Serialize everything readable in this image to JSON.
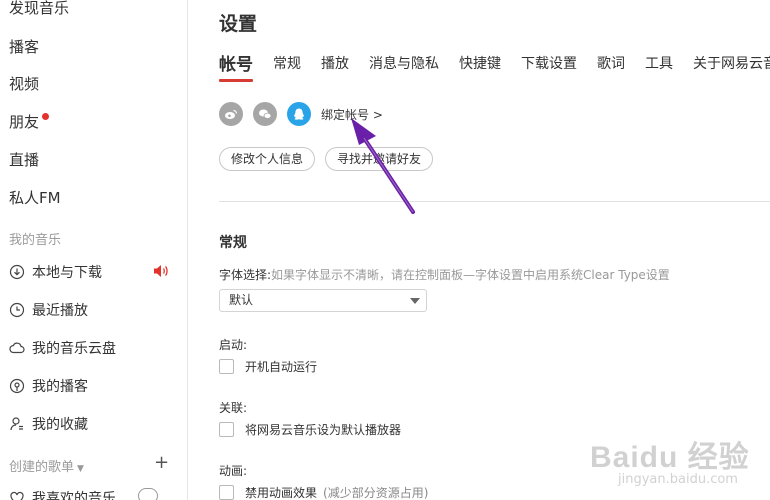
{
  "sidebar": {
    "nav": [
      {
        "label": "发现音乐"
      },
      {
        "label": "播客"
      },
      {
        "label": "视频"
      },
      {
        "label": "朋友"
      },
      {
        "label": "直播"
      },
      {
        "label": "私人FM"
      }
    ],
    "my_music_title": "我的音乐",
    "my_music": [
      {
        "label": "本地与下载",
        "icon": "download-icon"
      },
      {
        "label": "最近播放",
        "icon": "clock-icon"
      },
      {
        "label": "我的音乐云盘",
        "icon": "cloud-icon"
      },
      {
        "label": "我的播客",
        "icon": "podcast-icon"
      },
      {
        "label": "我的收藏",
        "icon": "collection-icon"
      }
    ],
    "created_playlists_title": "创建的歌单",
    "playlists": [
      {
        "label": "我喜欢的音乐"
      }
    ]
  },
  "main": {
    "title": "设置",
    "tabs": [
      {
        "label": "帐号"
      },
      {
        "label": "常规"
      },
      {
        "label": "播放"
      },
      {
        "label": "消息与隐私"
      },
      {
        "label": "快捷键"
      },
      {
        "label": "下载设置"
      },
      {
        "label": "歌词"
      },
      {
        "label": "工具"
      },
      {
        "label": "关于网易云音乐"
      }
    ],
    "account": {
      "bind_link": "绑定帐号 >",
      "edit_profile": "修改个人信息",
      "find_friends": "寻找并邀请好友"
    },
    "general": {
      "heading": "常规",
      "font_label": "字体选择:",
      "font_hint": "如果字体显示不清晰，请在控制面板—字体设置中启用系统Clear Type设置",
      "font_value": "默认",
      "startup_label": "启动:",
      "startup_option": "开机自动运行",
      "assoc_label": "关联:",
      "assoc_option": "将网易云音乐设为默认播放器",
      "anim_label": "动画:",
      "anim_option": "禁用动画效果",
      "anim_hint": "(减少部分资源占用)"
    }
  },
  "watermark": {
    "brand": "Baidu 经验",
    "url": "jingyan.baidu.com"
  },
  "colors": {
    "accent": "#d63b34",
    "arrow": "#6a1fa8",
    "qq": "#2aa4e8",
    "social_gray": "#a6a6a6"
  }
}
